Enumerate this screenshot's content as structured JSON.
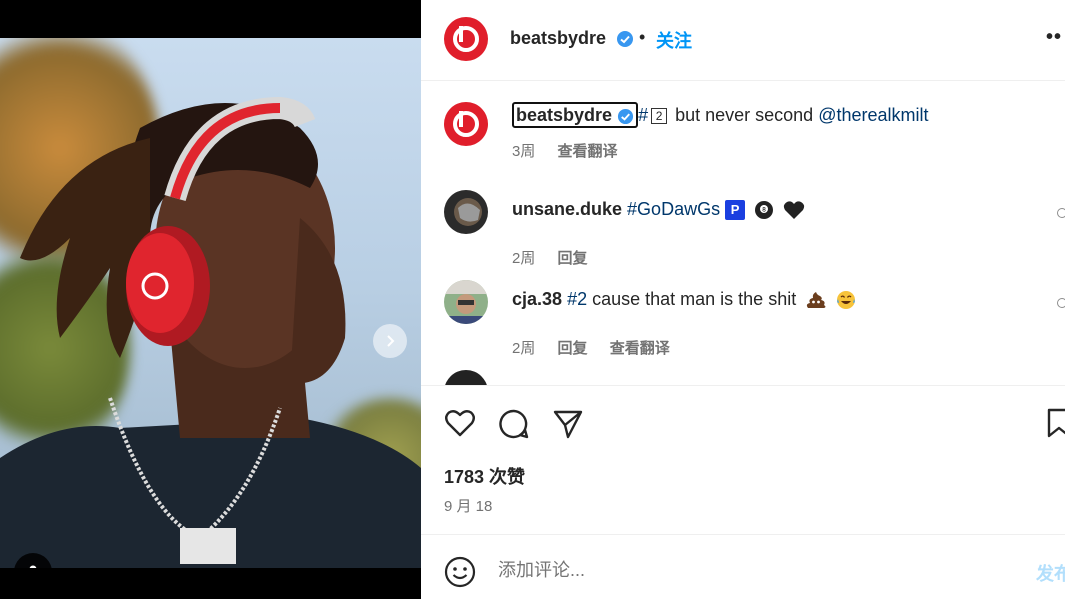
{
  "post": {
    "username": "beatsbydre",
    "follow_label": "关注",
    "dot": "•",
    "more_label": "••"
  },
  "caption": {
    "username": "beatsbydre",
    "hash": "#",
    "keycap": "2",
    "text_rest": " but never second ",
    "mention": "@therealkmilt",
    "time": "3周",
    "translate": "查看翻译"
  },
  "comments": [
    {
      "username": "unsane.duke",
      "hashtag": "#GoDawGs",
      "badge": "P",
      "time": "2周",
      "reply": "回复"
    },
    {
      "username": "cja.38",
      "hashtag": "#2",
      "text": " cause that man is the shit",
      "time": "2周",
      "reply": "回复",
      "translate": "查看翻译"
    }
  ],
  "likes_label": "1783 次赞",
  "date_label": "9 月 18",
  "add_comment": {
    "placeholder": "添加评论...",
    "post_label": "发布"
  },
  "colors": {
    "accent": "#0095f6",
    "beats_red": "#e01e2b",
    "link": "#00376b",
    "muted": "#737373"
  }
}
